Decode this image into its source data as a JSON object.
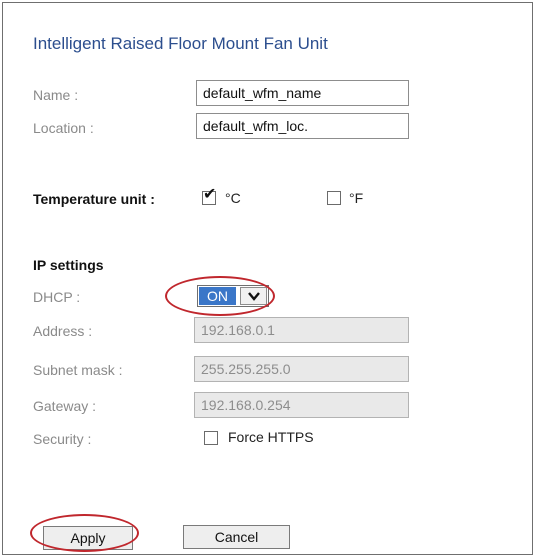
{
  "title": "Intelligent Raised Floor Mount Fan Unit",
  "general": {
    "name_label": "Name :",
    "name_value": "default_wfm_name",
    "location_label": "Location :",
    "location_value": "default_wfm_loc."
  },
  "temperature": {
    "label": "Temperature unit :",
    "celsius_label": "°C",
    "celsius_checked": true,
    "fahrenheit_label": "°F",
    "fahrenheit_checked": false
  },
  "ip_settings": {
    "heading": "IP settings",
    "dhcp_label": "DHCP :",
    "dhcp_value": "ON",
    "address_label": "Address :",
    "address_value": "192.168.0.1",
    "subnet_label": "Subnet mask :",
    "subnet_value": "255.255.255.0",
    "gateway_label": "Gateway :",
    "gateway_value": "192.168.0.254",
    "security_label": "Security :",
    "force_https_label": "Force HTTPS",
    "force_https_checked": false
  },
  "actions": {
    "apply_label": "Apply",
    "cancel_label": "Cancel"
  },
  "colors": {
    "title": "#2c4e8e",
    "highlight_ellipse": "#c0272d",
    "select_highlight": "#3a76c8"
  }
}
